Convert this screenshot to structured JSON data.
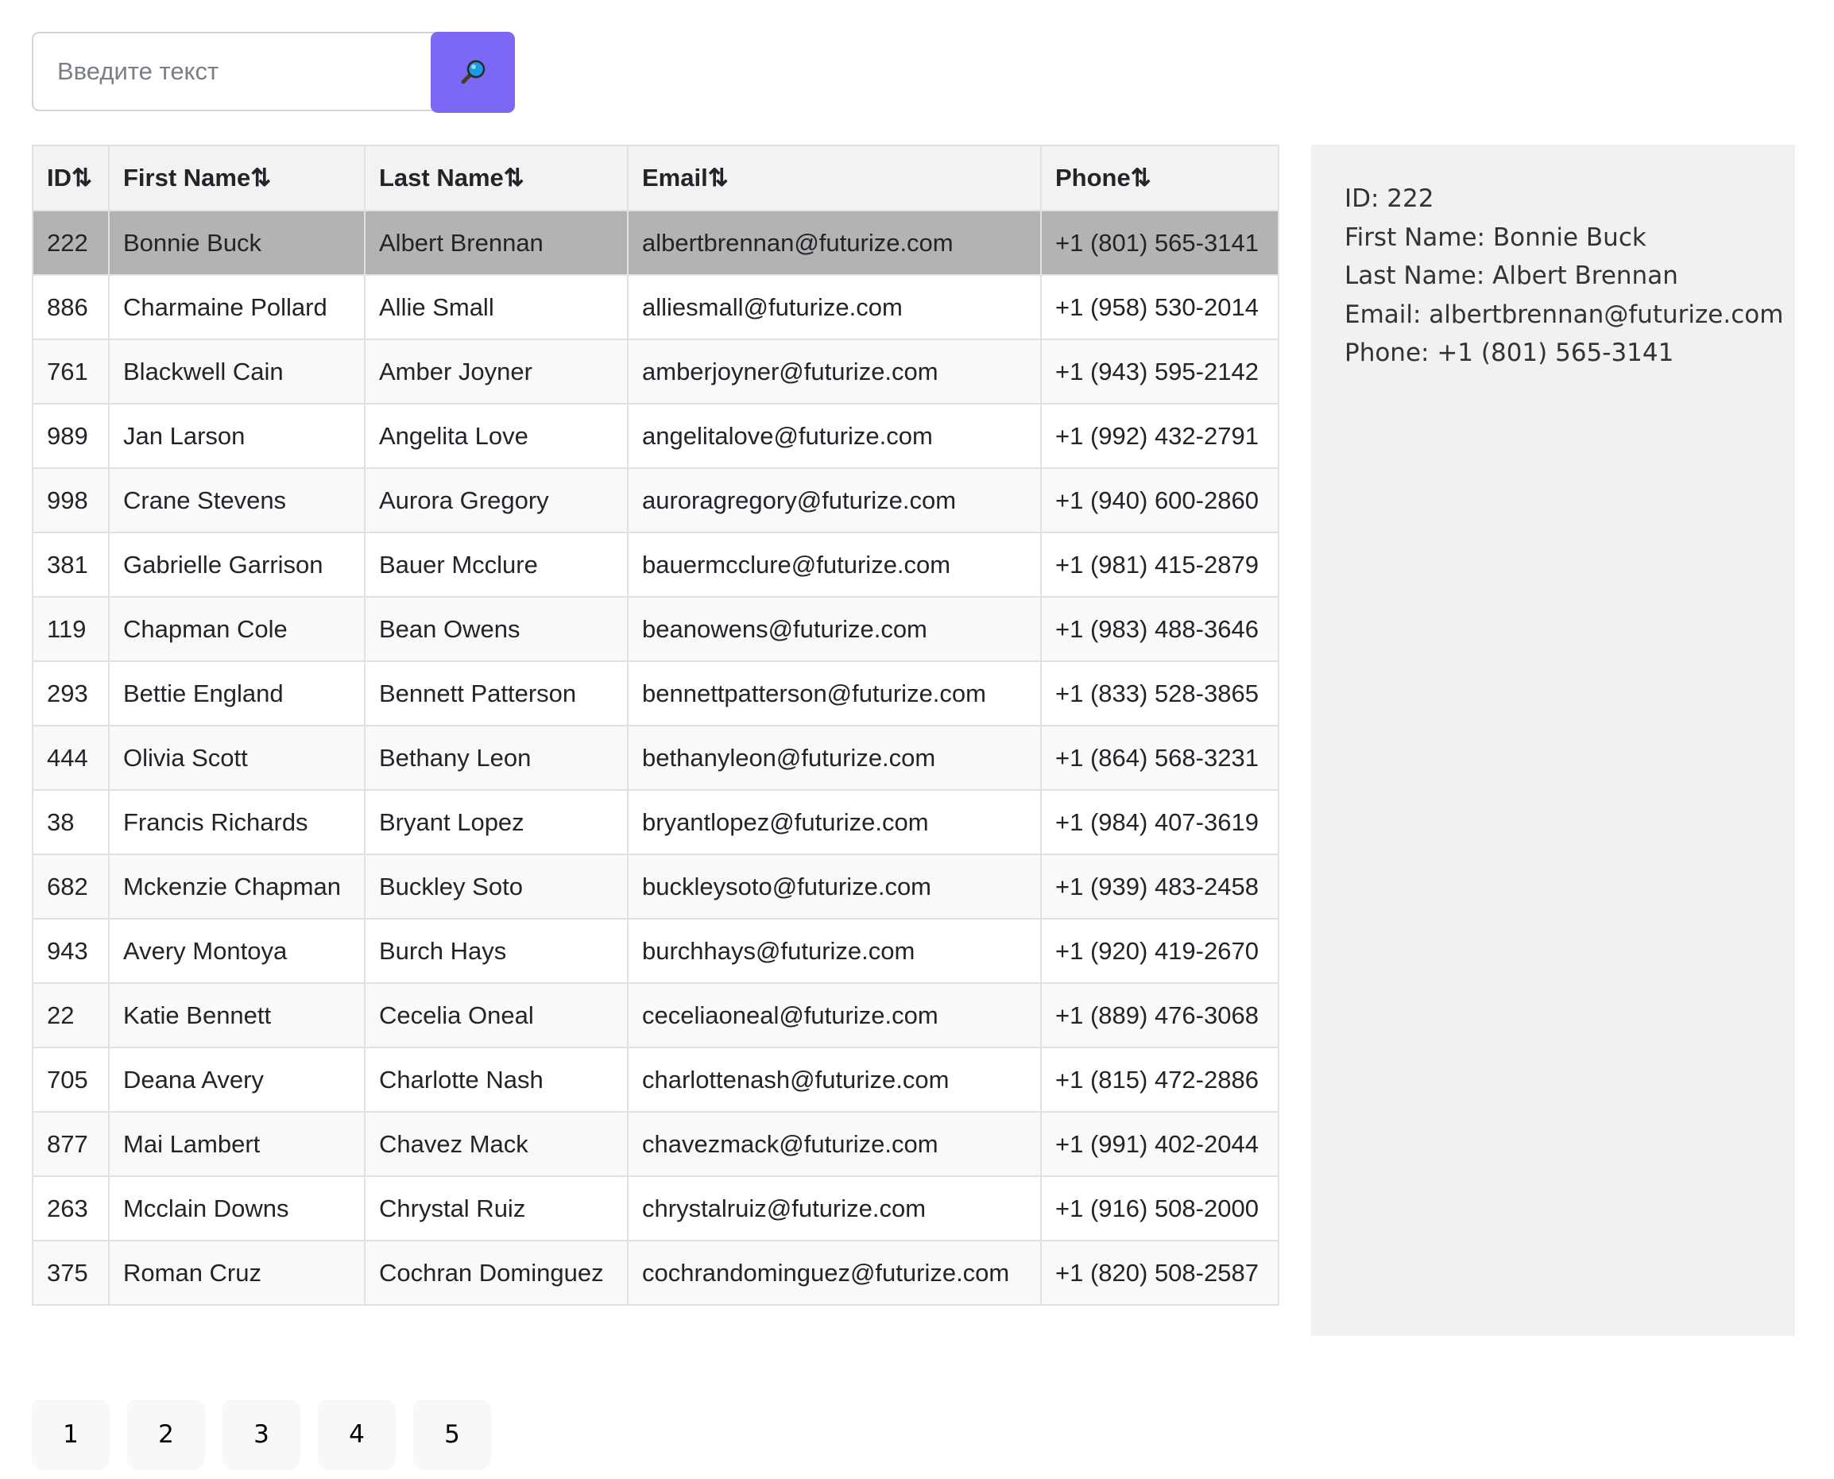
{
  "search": {
    "placeholder": "Введите текст",
    "value": "",
    "button_icon": "magnifier-icon"
  },
  "table": {
    "headers": [
      {
        "label": "ID",
        "sort_icon": "⇅"
      },
      {
        "label": "First Name",
        "sort_icon": "⇅"
      },
      {
        "label": "Last Name",
        "sort_icon": "⇅"
      },
      {
        "label": "Email",
        "sort_icon": "⇅"
      },
      {
        "label": "Phone",
        "sort_icon": "⇅"
      }
    ],
    "selected_row_index": 0,
    "rows": [
      {
        "id": "222",
        "first": "Bonnie Buck",
        "last": "Albert Brennan",
        "email": "albertbrennan@futurize.com",
        "phone": "+1 (801) 565-3141"
      },
      {
        "id": "886",
        "first": "Charmaine Pollard",
        "last": "Allie Small",
        "email": "alliesmall@futurize.com",
        "phone": "+1 (958) 530-2014"
      },
      {
        "id": "761",
        "first": "Blackwell Cain",
        "last": "Amber Joyner",
        "email": "amberjoyner@futurize.com",
        "phone": "+1 (943) 595-2142"
      },
      {
        "id": "989",
        "first": "Jan Larson",
        "last": "Angelita Love",
        "email": "angelitalove@futurize.com",
        "phone": "+1 (992) 432-2791"
      },
      {
        "id": "998",
        "first": "Crane Stevens",
        "last": "Aurora Gregory",
        "email": "auroragregory@futurize.com",
        "phone": "+1 (940) 600-2860"
      },
      {
        "id": "381",
        "first": "Gabrielle Garrison",
        "last": "Bauer Mcclure",
        "email": "bauermcclure@futurize.com",
        "phone": "+1 (981) 415-2879"
      },
      {
        "id": "119",
        "first": "Chapman Cole",
        "last": "Bean Owens",
        "email": "beanowens@futurize.com",
        "phone": "+1 (983) 488-3646"
      },
      {
        "id": "293",
        "first": "Bettie England",
        "last": "Bennett Patterson",
        "email": "bennettpatterson@futurize.com",
        "phone": "+1 (833) 528-3865"
      },
      {
        "id": "444",
        "first": "Olivia Scott",
        "last": "Bethany Leon",
        "email": "bethanyleon@futurize.com",
        "phone": "+1 (864) 568-3231"
      },
      {
        "id": "38",
        "first": "Francis Richards",
        "last": "Bryant Lopez",
        "email": "bryantlopez@futurize.com",
        "phone": "+1 (984) 407-3619"
      },
      {
        "id": "682",
        "first": "Mckenzie Chapman",
        "last": "Buckley Soto",
        "email": "buckleysoto@futurize.com",
        "phone": "+1 (939) 483-2458"
      },
      {
        "id": "943",
        "first": "Avery Montoya",
        "last": "Burch Hays",
        "email": "burchhays@futurize.com",
        "phone": "+1 (920) 419-2670"
      },
      {
        "id": "22",
        "first": "Katie Bennett",
        "last": "Cecelia Oneal",
        "email": "ceceliaoneal@futurize.com",
        "phone": "+1 (889) 476-3068"
      },
      {
        "id": "705",
        "first": "Deana Avery",
        "last": "Charlotte Nash",
        "email": "charlottenash@futurize.com",
        "phone": "+1 (815) 472-2886"
      },
      {
        "id": "877",
        "first": "Mai Lambert",
        "last": "Chavez Mack",
        "email": "chavezmack@futurize.com",
        "phone": "+1 (991) 402-2044"
      },
      {
        "id": "263",
        "first": "Mcclain Downs",
        "last": "Chrystal Ruiz",
        "email": "chrystalruiz@futurize.com",
        "phone": "+1 (916) 508-2000"
      },
      {
        "id": "375",
        "first": "Roman Cruz",
        "last": "Cochran Dominguez",
        "email": "cochrandominguez@futurize.com",
        "phone": "+1 (820) 508-2587"
      }
    ]
  },
  "detail": {
    "id": "ID: 222",
    "first_name": "First Name: Bonnie Buck",
    "last_name": "Last Name: Albert Brennan",
    "email": "Email: albertbrennan@futurize.com",
    "phone": "Phone: +1 (801) 565-3141"
  },
  "pagination": {
    "pages": [
      "1",
      "2",
      "3",
      "4",
      "5"
    ]
  },
  "colors": {
    "search_button": "#7b68f5",
    "selected_row": "#b3b3b3",
    "header_bg": "#f2f2f2",
    "detail_bg": "#f1f1f1"
  }
}
